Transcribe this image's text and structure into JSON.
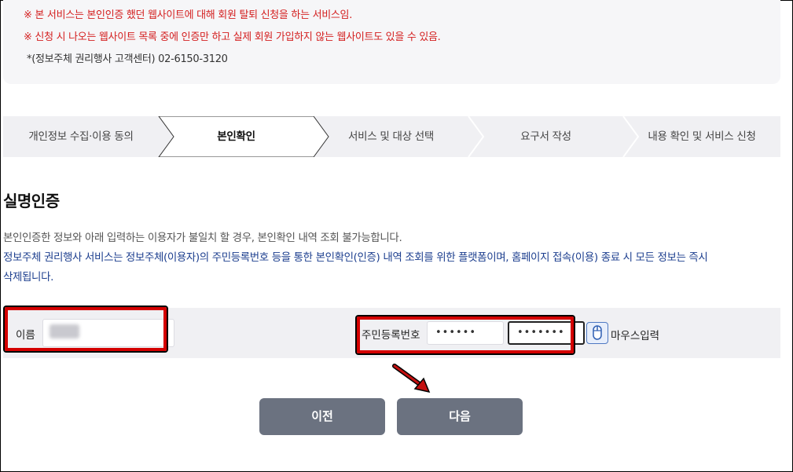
{
  "notice": {
    "line1": "※ 본 서비스는 본인인증 했던 웹사이트에 대해 회원 탈퇴 신청을 하는 서비스임.",
    "line2": "※ 신청 시 나오는 웹사이트 목록 중에 인증만 하고 실제 회원 가입하지 않는 웹사이트도 있을 수 있음.",
    "line3": "*(정보주체 권리행사 고객센터) 02-6150-3120"
  },
  "steps": [
    {
      "label": "개인정보 수집·이용 동의",
      "active": false
    },
    {
      "label": "본인확인",
      "active": true
    },
    {
      "label": "서비스 및 대상 선택",
      "active": false
    },
    {
      "label": "요구서 작성",
      "active": false
    },
    {
      "label": "내용 확인 및 서비스 신청",
      "active": false
    }
  ],
  "section": {
    "title": "실명인증",
    "desc1": "본인인증한 정보와 아래 입력하는 이용자가 불일치 할 경우, 본인확인 내역 조회 불가능합니다.",
    "desc2": "정보주체 권리행사 서비스는 정보주체(이용자)의 주민등록번호 등을 통한 본인확인(인증) 내역 조회를 위한 플랫폼이며, 홈페이지 접속(이용) 종료 시 모든 정보는 즉시",
    "desc3": "삭제됩니다."
  },
  "form": {
    "name_label": "이름",
    "rrn_label": "주민등록번호",
    "rrn_front": "••••••",
    "rrn_back": "•••••••",
    "mouse_input_label": "마우스입력"
  },
  "buttons": {
    "prev": "이전",
    "next": "다음"
  },
  "colors": {
    "notice_red": "#d42020",
    "desc_blue": "#1d3f8f",
    "button_gray": "#6b7280",
    "highlight_red": "#d40000"
  },
  "icons": [
    "mouse-icon",
    "annotation-arrow-icon"
  ]
}
